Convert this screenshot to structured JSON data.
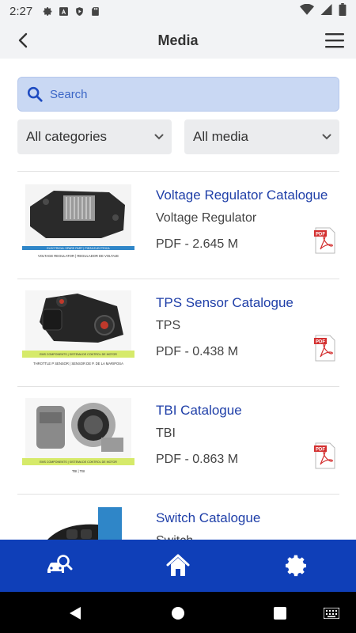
{
  "status_bar": {
    "time": "2:27"
  },
  "app_bar": {
    "title": "Media"
  },
  "search": {
    "placeholder": "Search",
    "value": ""
  },
  "filters": {
    "category_selected": "All categories",
    "media_selected": "All media"
  },
  "items": [
    {
      "title": "Voltage Regulator Catalogue",
      "category": "Voltage Regulator",
      "size": "PDF - 2.645 M",
      "thumb_caption_top": "ELECTRICAL SPARE PART | PIEZA ELECTRICA",
      "thumb_caption_bottom": "VOLTAGE REGULATOR | REGULADOR DE VOLTAJE",
      "icon": "pdf-icon"
    },
    {
      "title": "TPS Sensor Catalogue",
      "category": "TPS",
      "size": "PDF - 0.438 M",
      "thumb_caption_top": "EMS COMPONENTS | SISTEMA DE CONTROL DE MOTOR",
      "thumb_caption_bottom": "THROTTLE P SENSOR | SENSOR DE P. DE LA MARIPOSA",
      "icon": "pdf-icon"
    },
    {
      "title": "TBI Catalogue",
      "category": "TBI",
      "size": "PDF - 0.863 M",
      "thumb_caption_top": "EMS COMPONENTS | SISTEMA DE CONTROL DE MOTOR",
      "thumb_caption_bottom": "TBI | TBI",
      "icon": "pdf-icon"
    },
    {
      "title": "Switch Catalogue",
      "category": "Switch",
      "size": "",
      "icon": "pdf-icon"
    }
  ],
  "colors": {
    "accent": "#0f3fb8",
    "link": "#1f3fa8",
    "search_bg": "#c9d8f3",
    "thumb_band_green": "#d6ea6a",
    "thumb_band_blue": "#2f86c8"
  },
  "bottom_nav": [
    "car-search-icon",
    "home-icon",
    "settings-gear-icon"
  ]
}
